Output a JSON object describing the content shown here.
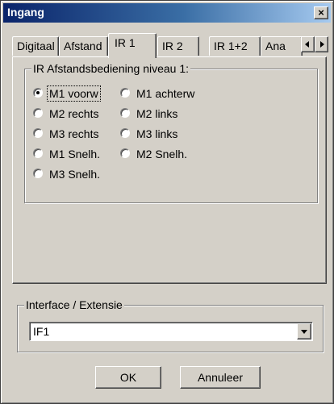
{
  "window": {
    "title": "Ingang",
    "close_label": "×"
  },
  "tabs": [
    {
      "label": "Digitaal",
      "active": false
    },
    {
      "label": "Afstand",
      "active": false
    },
    {
      "label": "IR 1",
      "active": true
    },
    {
      "label": "IR 2",
      "active": false
    },
    {
      "label": "IR 1+2",
      "active": false
    },
    {
      "label": "Ana",
      "active": false
    }
  ],
  "ir_group": {
    "legend": "IR Afstandsbediening niveau 1:",
    "options": [
      {
        "label": "M1 voorw",
        "selected": true
      },
      {
        "label": "M1 achterw",
        "selected": false
      },
      {
        "label": "M2 rechts",
        "selected": false
      },
      {
        "label": "M2 links",
        "selected": false
      },
      {
        "label": "M3 rechts",
        "selected": false
      },
      {
        "label": "M3 links",
        "selected": false
      },
      {
        "label": "M1 Snelh.",
        "selected": false
      },
      {
        "label": "M2 Snelh.",
        "selected": false
      },
      {
        "label": "M3 Snelh.",
        "selected": false
      }
    ]
  },
  "interface_group": {
    "legend": "Interface / Extensie",
    "selected_value": "IF1"
  },
  "buttons": {
    "ok": "OK",
    "cancel": "Annuleer"
  },
  "icons": {
    "close": "close-icon",
    "scroll_left": "arrow-left-icon",
    "scroll_right": "arrow-right-icon",
    "dropdown": "chevron-down-icon"
  }
}
